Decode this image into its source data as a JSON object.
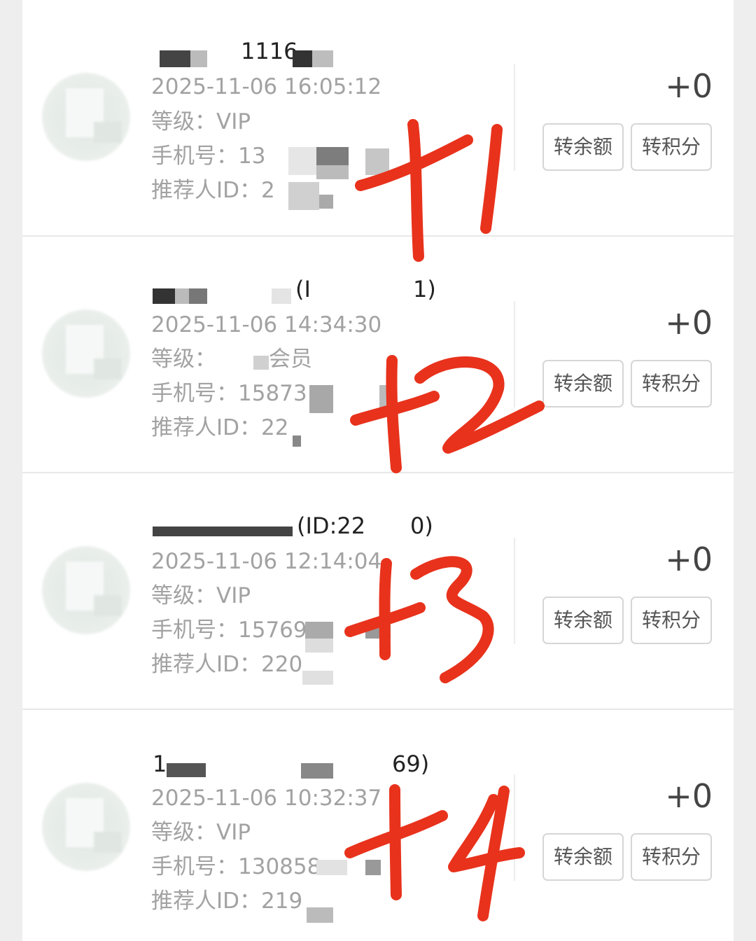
{
  "members": [
    {
      "name_visible": "1116",
      "time": "2025-11-06 16:05:12",
      "level": "等级：VIP",
      "phone": "手机号：13",
      "referrer": "推荐人ID：2",
      "score": "+0",
      "btn_balance": "转余额",
      "btn_points": "转积分",
      "mark": "+1"
    },
    {
      "name_visible": "(I",
      "name_tail": "1)",
      "time": "2025-11-06 14:34:30",
      "level": "等级：",
      "level_suffix": "会员",
      "phone": "手机号：15873",
      "referrer": "推荐人ID：22",
      "score": "+0",
      "btn_balance": "转余额",
      "btn_points": "转积分",
      "mark": "+2"
    },
    {
      "name_visible": "(ID:22",
      "name_tail": "0)",
      "time": "2025-11-06 12:14:04",
      "level": "等级：VIP",
      "phone": "手机号：15769",
      "referrer": "推荐人ID：220",
      "score": "+0",
      "btn_balance": "转余额",
      "btn_points": "转积分",
      "mark": "+3"
    },
    {
      "name_visible": "1",
      "name_tail": "69)",
      "time": "2025-11-06 10:32:37",
      "level": "等级：VIP",
      "phone": "手机号：130858",
      "referrer": "推荐人ID：219",
      "score": "+0",
      "btn_balance": "转余额",
      "btn_points": "转积分",
      "mark": "+4"
    }
  ],
  "colors": {
    "handwriting": "#e8321c",
    "background": "#eeeeee",
    "card": "#ffffff"
  }
}
